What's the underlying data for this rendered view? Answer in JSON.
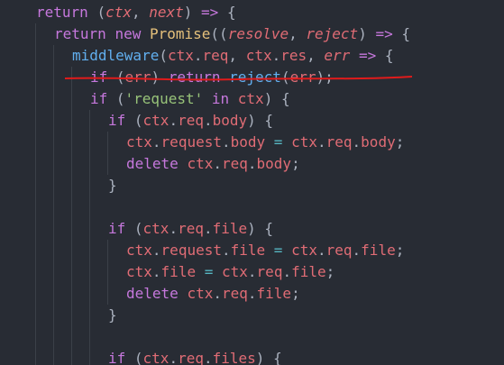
{
  "code": {
    "lines": [
      {
        "indent": 2,
        "tokens": [
          {
            "t": "return",
            "c": "kw"
          },
          {
            "t": " ",
            "c": "pun"
          },
          {
            "t": "(",
            "c": "pun"
          },
          {
            "t": "ctx",
            "c": "prm"
          },
          {
            "t": ", ",
            "c": "pun"
          },
          {
            "t": "next",
            "c": "prm"
          },
          {
            "t": ") ",
            "c": "pun"
          },
          {
            "t": "=>",
            "c": "kw"
          },
          {
            "t": " {",
            "c": "pun"
          }
        ]
      },
      {
        "indent": 3,
        "tokens": [
          {
            "t": "return",
            "c": "kw"
          },
          {
            "t": " ",
            "c": "pun"
          },
          {
            "t": "new",
            "c": "kw"
          },
          {
            "t": " ",
            "c": "pun"
          },
          {
            "t": "Promise",
            "c": "cls"
          },
          {
            "t": "((",
            "c": "pun"
          },
          {
            "t": "resolve",
            "c": "prm"
          },
          {
            "t": ", ",
            "c": "pun"
          },
          {
            "t": "reject",
            "c": "prm"
          },
          {
            "t": ") ",
            "c": "pun"
          },
          {
            "t": "=>",
            "c": "kw"
          },
          {
            "t": " {",
            "c": "pun"
          }
        ]
      },
      {
        "indent": 4,
        "tokens": [
          {
            "t": "middleware",
            "c": "fn"
          },
          {
            "t": "(",
            "c": "pun"
          },
          {
            "t": "ctx",
            "c": "var"
          },
          {
            "t": ".",
            "c": "pun"
          },
          {
            "t": "req",
            "c": "prop"
          },
          {
            "t": ", ",
            "c": "pun"
          },
          {
            "t": "ctx",
            "c": "var"
          },
          {
            "t": ".",
            "c": "pun"
          },
          {
            "t": "res",
            "c": "prop"
          },
          {
            "t": ", ",
            "c": "pun"
          },
          {
            "t": "err",
            "c": "prm"
          },
          {
            "t": " ",
            "c": "pun"
          },
          {
            "t": "=>",
            "c": "kw"
          },
          {
            "t": " {",
            "c": "pun"
          }
        ]
      },
      {
        "indent": 5,
        "tokens": [
          {
            "t": "if",
            "c": "kw"
          },
          {
            "t": " (",
            "c": "pun"
          },
          {
            "t": "err",
            "c": "var"
          },
          {
            "t": ") ",
            "c": "pun"
          },
          {
            "t": "return",
            "c": "kw"
          },
          {
            "t": " ",
            "c": "pun"
          },
          {
            "t": "reject",
            "c": "fn"
          },
          {
            "t": "(",
            "c": "pun"
          },
          {
            "t": "err",
            "c": "var"
          },
          {
            "t": ");",
            "c": "pun"
          }
        ]
      },
      {
        "indent": 5,
        "tokens": [
          {
            "t": "if",
            "c": "kw"
          },
          {
            "t": " (",
            "c": "pun"
          },
          {
            "t": "'request'",
            "c": "str"
          },
          {
            "t": " ",
            "c": "pun"
          },
          {
            "t": "in",
            "c": "kw"
          },
          {
            "t": " ",
            "c": "pun"
          },
          {
            "t": "ctx",
            "c": "var"
          },
          {
            "t": ") {",
            "c": "pun"
          }
        ]
      },
      {
        "indent": 6,
        "tokens": [
          {
            "t": "if",
            "c": "kw"
          },
          {
            "t": " (",
            "c": "pun"
          },
          {
            "t": "ctx",
            "c": "var"
          },
          {
            "t": ".",
            "c": "pun"
          },
          {
            "t": "req",
            "c": "prop"
          },
          {
            "t": ".",
            "c": "pun"
          },
          {
            "t": "body",
            "c": "prop"
          },
          {
            "t": ") {",
            "c": "pun"
          }
        ]
      },
      {
        "indent": 7,
        "tokens": [
          {
            "t": "ctx",
            "c": "var"
          },
          {
            "t": ".",
            "c": "pun"
          },
          {
            "t": "request",
            "c": "prop"
          },
          {
            "t": ".",
            "c": "pun"
          },
          {
            "t": "body",
            "c": "prop"
          },
          {
            "t": " ",
            "c": "pun"
          },
          {
            "t": "=",
            "c": "op"
          },
          {
            "t": " ",
            "c": "pun"
          },
          {
            "t": "ctx",
            "c": "var"
          },
          {
            "t": ".",
            "c": "pun"
          },
          {
            "t": "req",
            "c": "prop"
          },
          {
            "t": ".",
            "c": "pun"
          },
          {
            "t": "body",
            "c": "prop"
          },
          {
            "t": ";",
            "c": "pun"
          }
        ]
      },
      {
        "indent": 7,
        "tokens": [
          {
            "t": "delete",
            "c": "kw"
          },
          {
            "t": " ",
            "c": "pun"
          },
          {
            "t": "ctx",
            "c": "var"
          },
          {
            "t": ".",
            "c": "pun"
          },
          {
            "t": "req",
            "c": "prop"
          },
          {
            "t": ".",
            "c": "pun"
          },
          {
            "t": "body",
            "c": "prop"
          },
          {
            "t": ";",
            "c": "pun"
          }
        ]
      },
      {
        "indent": 6,
        "tokens": [
          {
            "t": "}",
            "c": "pun"
          }
        ]
      },
      {
        "indent": 0,
        "tokens": []
      },
      {
        "indent": 6,
        "tokens": [
          {
            "t": "if",
            "c": "kw"
          },
          {
            "t": " (",
            "c": "pun"
          },
          {
            "t": "ctx",
            "c": "var"
          },
          {
            "t": ".",
            "c": "pun"
          },
          {
            "t": "req",
            "c": "prop"
          },
          {
            "t": ".",
            "c": "pun"
          },
          {
            "t": "file",
            "c": "prop"
          },
          {
            "t": ") {",
            "c": "pun"
          }
        ]
      },
      {
        "indent": 7,
        "tokens": [
          {
            "t": "ctx",
            "c": "var"
          },
          {
            "t": ".",
            "c": "pun"
          },
          {
            "t": "request",
            "c": "prop"
          },
          {
            "t": ".",
            "c": "pun"
          },
          {
            "t": "file",
            "c": "prop"
          },
          {
            "t": " ",
            "c": "pun"
          },
          {
            "t": "=",
            "c": "op"
          },
          {
            "t": " ",
            "c": "pun"
          },
          {
            "t": "ctx",
            "c": "var"
          },
          {
            "t": ".",
            "c": "pun"
          },
          {
            "t": "req",
            "c": "prop"
          },
          {
            "t": ".",
            "c": "pun"
          },
          {
            "t": "file",
            "c": "prop"
          },
          {
            "t": ";",
            "c": "pun"
          }
        ]
      },
      {
        "indent": 7,
        "tokens": [
          {
            "t": "ctx",
            "c": "var"
          },
          {
            "t": ".",
            "c": "pun"
          },
          {
            "t": "file",
            "c": "prop"
          },
          {
            "t": " ",
            "c": "pun"
          },
          {
            "t": "=",
            "c": "op"
          },
          {
            "t": " ",
            "c": "pun"
          },
          {
            "t": "ctx",
            "c": "var"
          },
          {
            "t": ".",
            "c": "pun"
          },
          {
            "t": "req",
            "c": "prop"
          },
          {
            "t": ".",
            "c": "pun"
          },
          {
            "t": "file",
            "c": "prop"
          },
          {
            "t": ";",
            "c": "pun"
          }
        ]
      },
      {
        "indent": 7,
        "tokens": [
          {
            "t": "delete",
            "c": "kw"
          },
          {
            "t": " ",
            "c": "pun"
          },
          {
            "t": "ctx",
            "c": "var"
          },
          {
            "t": ".",
            "c": "pun"
          },
          {
            "t": "req",
            "c": "prop"
          },
          {
            "t": ".",
            "c": "pun"
          },
          {
            "t": "file",
            "c": "prop"
          },
          {
            "t": ";",
            "c": "pun"
          }
        ]
      },
      {
        "indent": 6,
        "tokens": [
          {
            "t": "}",
            "c": "pun"
          }
        ]
      },
      {
        "indent": 0,
        "tokens": []
      },
      {
        "indent": 6,
        "tokens": [
          {
            "t": "if",
            "c": "kw"
          },
          {
            "t": " (",
            "c": "pun"
          },
          {
            "t": "ctx",
            "c": "var"
          },
          {
            "t": ".",
            "c": "pun"
          },
          {
            "t": "req",
            "c": "prop"
          },
          {
            "t": ".",
            "c": "pun"
          },
          {
            "t": "files",
            "c": "prop"
          },
          {
            "t": ") {",
            "c": "pun"
          }
        ]
      }
    ]
  },
  "annotation": {
    "color": "#e01b1b",
    "target": "middleware(ctx.req, ctx.res, err => {"
  },
  "theme": {
    "background": "#282c34",
    "indent_guide": "#3b4048"
  }
}
